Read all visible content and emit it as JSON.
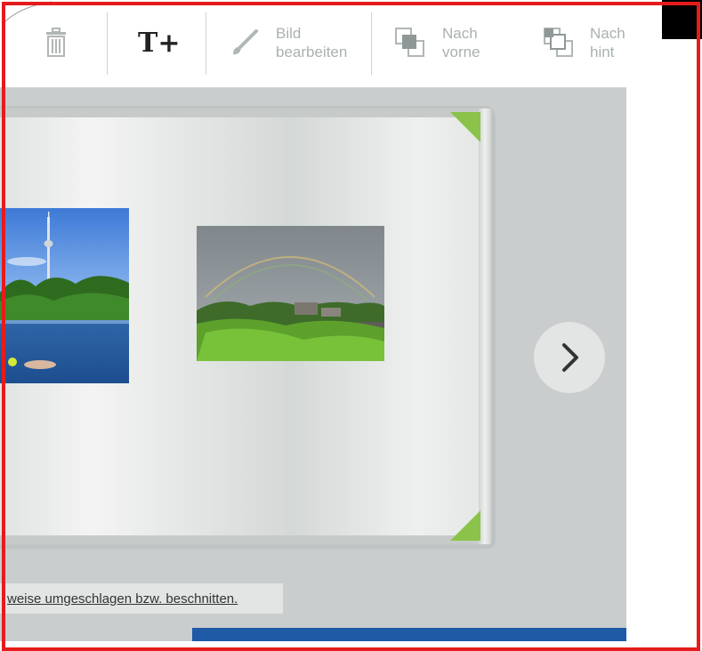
{
  "toolbar": {
    "delete": {
      "icon": "trash-icon"
    },
    "add_text": {
      "icon": "add-text-icon",
      "glyph": "T+"
    },
    "edit_image": {
      "icon": "brush-icon",
      "label": "Bild\nbearbeiten"
    },
    "bring_forward": {
      "icon": "bring-forward-icon",
      "label": "Nach\nvorne"
    },
    "send_backward": {
      "icon": "send-backward-icon",
      "label": "Nach\nhint"
    }
  },
  "canvas": {
    "photos": [
      {
        "name": "photo-tower-lake",
        "description_icon": "image"
      },
      {
        "name": "photo-rainbow"
      }
    ],
    "next": {
      "icon": "chevron-right-icon"
    }
  },
  "notice": {
    "text": "weise umgeschlagen bzw. beschnitten."
  },
  "colors": {
    "accent": "#1f5aa6",
    "corner_green": "#8bc34a",
    "frame": "#e51c1c"
  }
}
